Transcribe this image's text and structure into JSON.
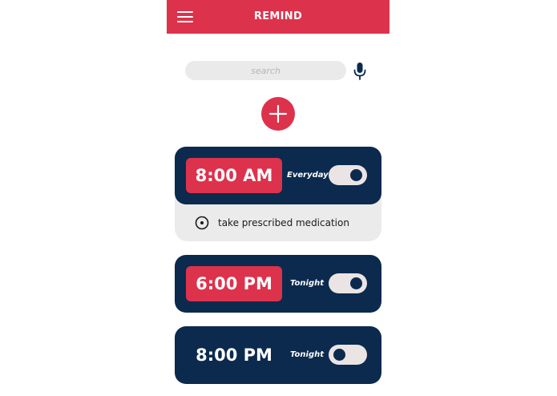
{
  "header": {
    "title": "REMIND",
    "menu_icon": "hamburger-menu-icon"
  },
  "search": {
    "placeholder": "search",
    "value": "",
    "mic_icon": "microphone-icon"
  },
  "add_button": {
    "icon": "plus-icon"
  },
  "colors": {
    "accent": "#dd324c",
    "navy": "#0b2a4e",
    "light_gray": "#ebebeb"
  },
  "reminders": [
    {
      "time": "8:00 AM",
      "frequency": "Everyday",
      "enabled": true,
      "expanded": true,
      "task": "take prescribed medication"
    },
    {
      "time": "6:00 PM",
      "frequency": "Tonight",
      "enabled": true,
      "expanded": false
    },
    {
      "time": "8:00 PM",
      "frequency": "Tonight",
      "enabled": false,
      "expanded": false
    }
  ]
}
